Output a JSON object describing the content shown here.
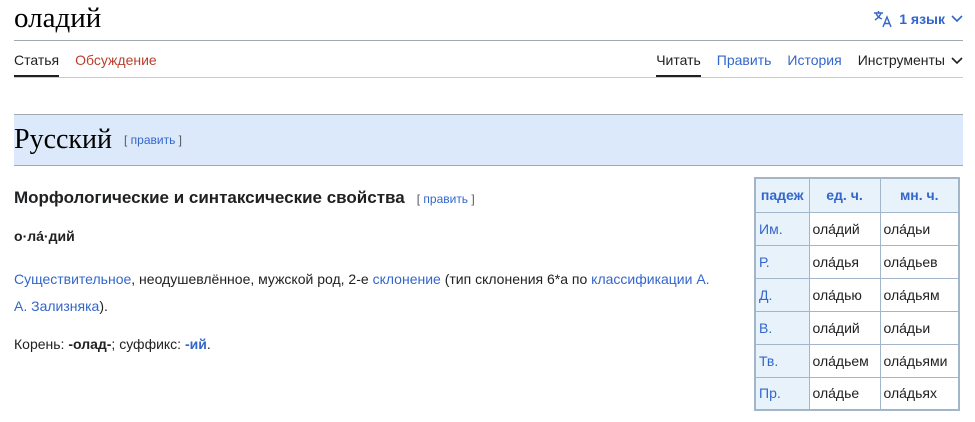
{
  "page": {
    "title": "оладий",
    "language_button": "1 язык"
  },
  "tabs": {
    "left": [
      "Статья",
      "Обсуждение"
    ],
    "right": [
      "Читать",
      "Править",
      "История"
    ],
    "tools": "Инструменты"
  },
  "section": {
    "heading": "Русский",
    "edit": "править"
  },
  "morph": {
    "heading": "Морфологические и синтаксические свойства",
    "edit": "править",
    "stress_parts": [
      "о",
      "·",
      "ла́",
      "·",
      "дий"
    ],
    "description": {
      "link1": "Существительное",
      "text1": ", неодушевлённое, мужской род, 2-е ",
      "link2": "склонение",
      "text2": " (тип склонения 6*a по ",
      "link3": "классификации А. А. Зализняка",
      "text3": ")."
    },
    "root": {
      "label": "Корень: ",
      "root_value": "-олад-",
      "sep": "; суффикс: ",
      "suffix_value": "-ий",
      "end": "."
    }
  },
  "declension": {
    "headers": [
      "падеж",
      "ед. ч.",
      "мн. ч."
    ],
    "rows": [
      {
        "case": "Им.",
        "sg": "ола́дий",
        "pl": "ола́дьи"
      },
      {
        "case": "Р.",
        "sg": "ола́дья",
        "pl": "ола́дьев"
      },
      {
        "case": "Д.",
        "sg": "ола́дью",
        "pl": "ола́дьям"
      },
      {
        "case": "В.",
        "sg": "ола́дий",
        "pl": "ола́дьи"
      },
      {
        "case": "Тв.",
        "sg": "ола́дьем",
        "pl": "ола́дьями"
      },
      {
        "case": "Пр.",
        "sg": "ола́дье",
        "pl": "ола́дьях"
      }
    ]
  },
  "colors": {
    "link": "#3366cc",
    "red_link": "#ba3f2e",
    "section_bg": "#dbe9fa",
    "table_header_bg": "#e8f2fb"
  }
}
